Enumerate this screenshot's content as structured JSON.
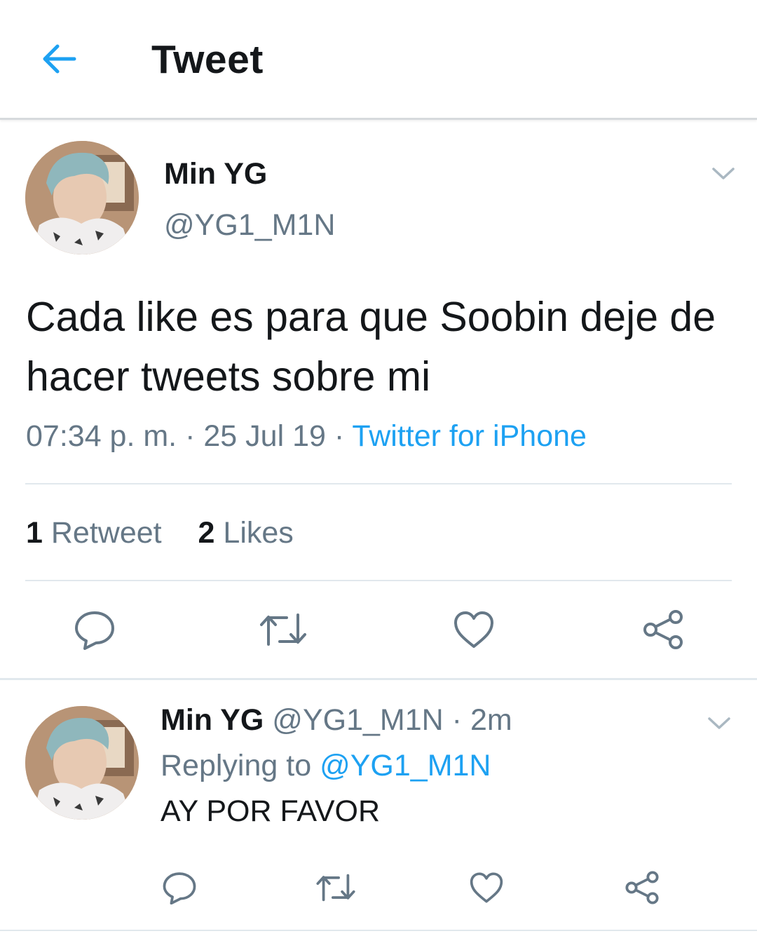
{
  "header": {
    "title": "Tweet",
    "back_icon": "arrow-left-icon"
  },
  "colors": {
    "accent": "#1da1f2",
    "secondary_text": "#657786",
    "divider": "#e1e8ed"
  },
  "main_tweet": {
    "display_name": "Min YG",
    "handle": "@YG1_M1N",
    "text": "Cada like es para que Soobin deje de hacer tweets sobre mi",
    "time": "07:34 p. m.",
    "date": "25 Jul 19",
    "source": "Twitter for iPhone",
    "dot": "·",
    "retweet_count": "1",
    "retweet_label": "Retweet",
    "like_count": "2",
    "like_label": "Likes"
  },
  "reply": {
    "display_name": "Min YG",
    "handle": "@YG1_M1N",
    "age": "2m",
    "dot": "·",
    "replying_label": "Replying to",
    "replying_handle": "@YG1_M1N",
    "text": "AY POR FAVOR"
  },
  "actions": [
    "reply-icon",
    "retweet-icon",
    "like-icon",
    "share-icon"
  ]
}
